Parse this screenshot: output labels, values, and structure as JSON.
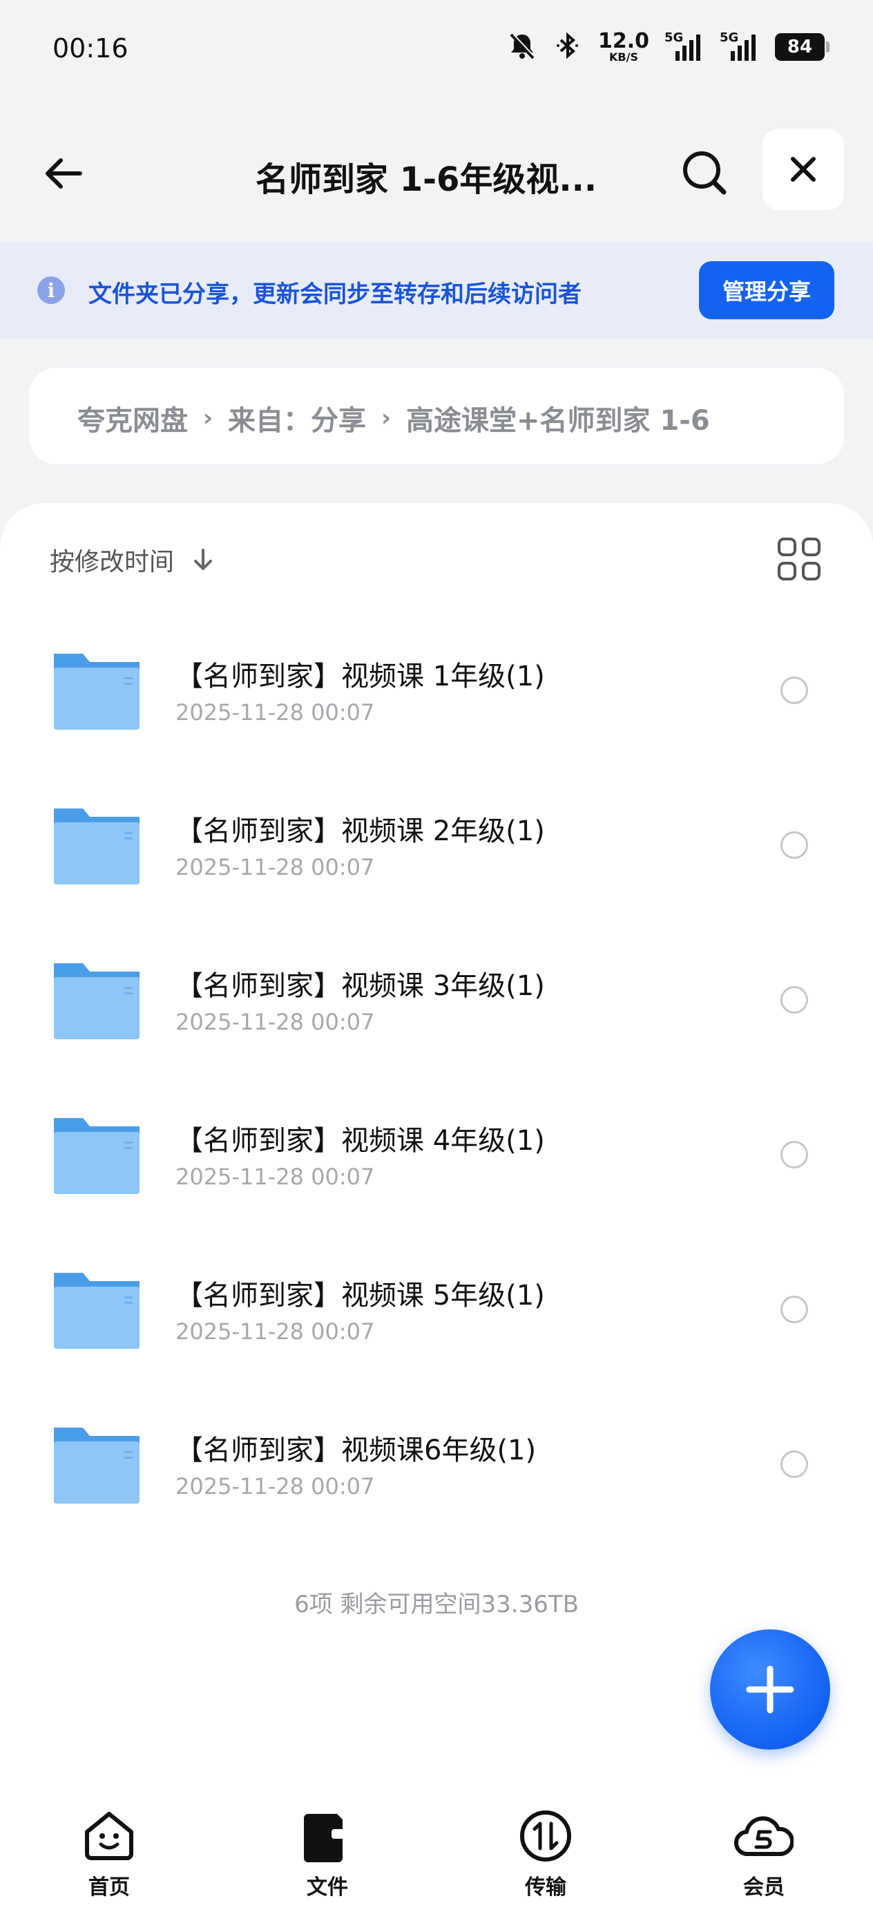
{
  "status_bar": {
    "time": "00:16",
    "net_speed_value": "12.0",
    "net_speed_unit": "KB/S",
    "sim1_label": "5G",
    "sim2_label": "5G",
    "battery": "84"
  },
  "header": {
    "title": "名师到家 1-6年级视..."
  },
  "notice": {
    "message": "文件夹已分享，更新会同步至转存和后续访问者",
    "manage_label": "管理分享"
  },
  "breadcrumb": {
    "items": [
      "夸克网盘",
      "来自：分享",
      "高途课堂+名师到家 1-6"
    ],
    "separator": "›"
  },
  "toolbar": {
    "sort_label": "按修改时间"
  },
  "files": [
    {
      "name": "【名师到家】视频课 1年级(1)",
      "date": "2025-11-28 00:07"
    },
    {
      "name": "【名师到家】视频课 2年级(1)",
      "date": "2025-11-28 00:07"
    },
    {
      "name": "【名师到家】视频课 3年级(1)",
      "date": "2025-11-28 00:07"
    },
    {
      "name": "【名师到家】视频课 4年级(1)",
      "date": "2025-11-28 00:07"
    },
    {
      "name": "【名师到家】视频课 5年级(1)",
      "date": "2025-11-28 00:07"
    },
    {
      "name": "【名师到家】视频课6年级(1)",
      "date": "2025-11-28 00:07"
    }
  ],
  "summary": "6项 剩余可用空间33.36TB",
  "bottom_nav": {
    "home": "首页",
    "files": "文件",
    "transfer": "传输",
    "member": "会员"
  },
  "colors": {
    "accent": "#1363f0",
    "banner_bg": "#e8ecf8",
    "folder_blue": "#5aa9ee"
  }
}
